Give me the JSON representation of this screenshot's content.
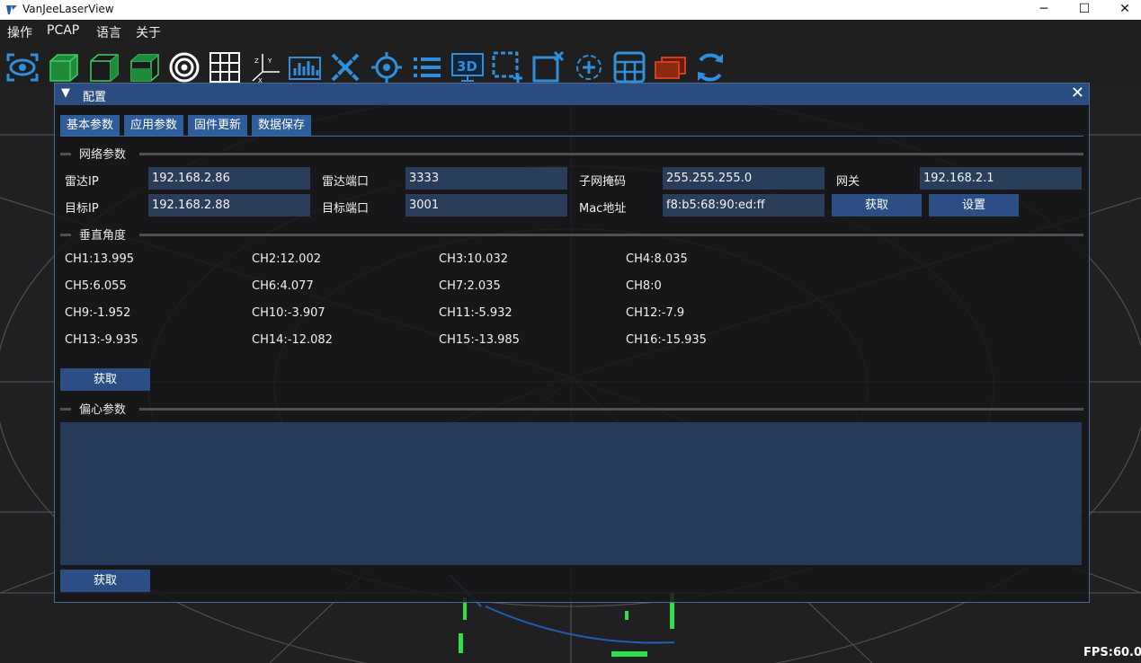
{
  "window": {
    "title": "VanJeeLaserView",
    "minimize": "─",
    "maximize": "☐",
    "close": "✕"
  },
  "menu": [
    "操作",
    "PCAP",
    "语言",
    "关于"
  ],
  "toolbar": [
    "eye-icon",
    "cube-front-icon",
    "cube-side-icon",
    "cube-top-icon",
    "target-icon",
    "grid-icon",
    "axis-icon",
    "histogram-icon",
    "measure-icon",
    "crosshair-icon",
    "list-icon",
    "3d-view-icon",
    "select-region-icon",
    "delete-region-icon",
    "locate-icon",
    "table-icon",
    "layers-icon",
    "refresh-icon"
  ],
  "dialog": {
    "title": "配置",
    "arrow": "▼",
    "close": "✕",
    "tabs": [
      "基本参数",
      "应用参数",
      "固件更新",
      "数据保存"
    ],
    "network": {
      "section": "网络参数",
      "lidar_ip_label": "雷达IP",
      "lidar_ip": "192.168.2.86",
      "lidar_port_label": "雷达端口",
      "lidar_port": "3333",
      "subnet_label": "子网掩码",
      "subnet": "255.255.255.0",
      "gateway_label": "网关",
      "gateway": "192.168.2.1",
      "target_ip_label": "目标IP",
      "target_ip": "192.168.2.88",
      "target_port_label": "目标端口",
      "target_port": "3001",
      "mac_label": "Mac地址",
      "mac": "f8:b5:68:90:ed:ff",
      "get_button": "获取",
      "set_button": "设置"
    },
    "vertical": {
      "section": "垂直角度",
      "channels": [
        "CH1:13.995",
        "CH2:12.002",
        "CH3:10.032",
        "CH4:8.035",
        "CH5:6.055",
        "CH6:4.077",
        "CH7:2.035",
        "CH8:0",
        "CH9:-1.952",
        "CH10:-3.907",
        "CH11:-5.932",
        "CH12:-7.9",
        "CH13:-9.935",
        "CH14:-12.082",
        "CH15:-13.985",
        "CH16:-15.935"
      ],
      "get_button": "获取"
    },
    "eccentric": {
      "section": "偏心参数",
      "get_button": "获取"
    }
  },
  "fps": "FPS:60.0",
  "colors": {
    "accent": "#2b4c7e",
    "tab": "#2f5d99",
    "field": "#2a3d5a",
    "icon_blue": "#2f8fdc",
    "icon_green": "#2fb84a",
    "icon_red": "#d0401f"
  }
}
